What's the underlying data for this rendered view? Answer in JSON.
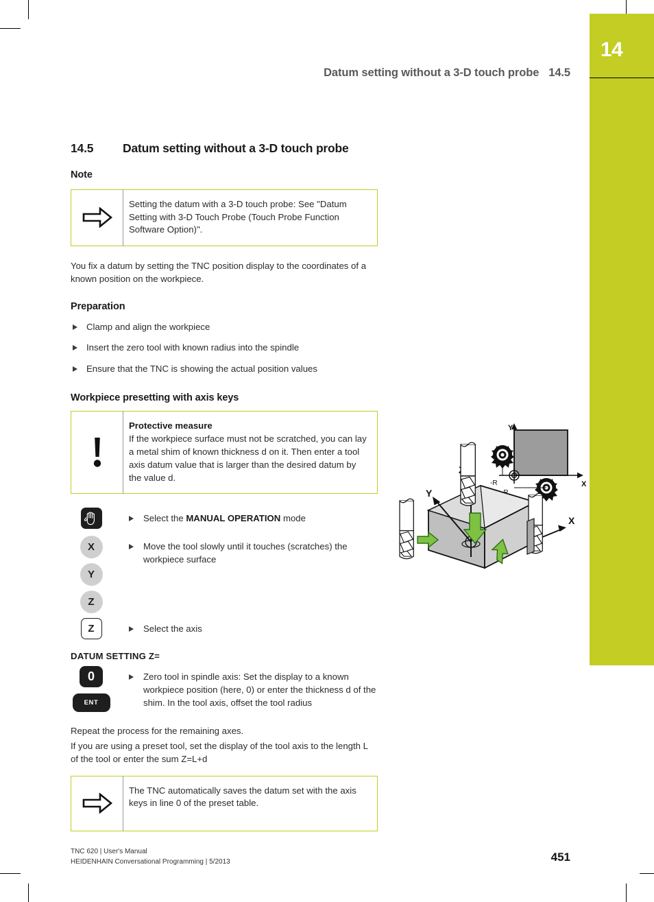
{
  "chapter": {
    "number": "14",
    "accent_color": "#c3cd23"
  },
  "running_header": {
    "title": "Datum setting without a 3-D touch probe",
    "section_number": "14.5"
  },
  "section": {
    "number": "14.5",
    "title": "Datum setting without a 3-D touch probe"
  },
  "note_heading": "Note",
  "note_box": {
    "icon": "arrow-right-outline-icon",
    "text": "Setting the datum with a 3-D touch probe: See \"Datum Setting with 3-D Touch Probe (Touch Probe Function Software Option)\"."
  },
  "intro_paragraph": "You fix a datum by setting the TNC position display to the coordinates of a known position on the workpiece.",
  "preparation": {
    "heading": "Preparation",
    "items": [
      "Clamp and align the workpiece",
      "Insert the zero tool with known radius into the spindle",
      "Ensure that the TNC is showing the actual position values"
    ]
  },
  "presetting": {
    "heading": "Workpiece presetting with axis keys"
  },
  "warning_box": {
    "icon": "exclamation-mark-icon",
    "title": "Protective measure",
    "text": "If the workpiece surface must not be scratched, you can lay a metal shim of known thickness d on it. Then enter a tool axis datum value that is larger than the desired datum by the value d."
  },
  "key_steps": [
    {
      "key_type": "dark-square-hand",
      "key_label": "",
      "icon": "hand-icon",
      "text_before": "Select the ",
      "text_bold": "MANUAL OPERATION",
      "text_after": " mode"
    },
    {
      "key_type": "circle",
      "key_label": "X",
      "icon": "axis-key-x-icon",
      "text_before": "Move the tool slowly until it touches (scratches) the workpiece surface",
      "text_bold": "",
      "text_after": ""
    },
    {
      "key_type": "circle",
      "key_label": "Y",
      "icon": "axis-key-y-icon",
      "text_before": "",
      "text_bold": "",
      "text_after": ""
    },
    {
      "key_type": "circle",
      "key_label": "Z",
      "icon": "axis-key-z-icon",
      "text_before": "",
      "text_bold": "",
      "text_after": ""
    },
    {
      "key_type": "outline-square",
      "key_label": "Z",
      "icon": "soft-key-z-icon",
      "text_before": "Select the axis",
      "text_bold": "",
      "text_after": ""
    }
  ],
  "datum_setting": {
    "label": "DATUM SETTING Z=",
    "key_zero": "0",
    "key_ent": "ENT",
    "text": "Zero tool in spindle axis: Set the display to a known workpiece position (here, 0) or enter the thickness d of the shim. In the tool axis, offset the tool radius"
  },
  "closing": {
    "line1": "Repeat the process for the remaining axes.",
    "line2": "If you are using a preset tool, set the display of the tool axis to the length L of the tool or enter the sum Z=L+d"
  },
  "final_note_box": {
    "icon": "arrow-right-outline-icon",
    "text": "The TNC automatically saves the datum set with the axis keys in line 0 of the preset table."
  },
  "figure": {
    "name": "datum-setting-workpiece-illustration",
    "axis_labels": {
      "x": "X",
      "y": "Y",
      "z": "Z"
    },
    "inset": {
      "axis_x": "X",
      "axis_y": "Y",
      "radius_label_left": "-R",
      "radius_label_bottom": "-R"
    }
  },
  "footer": {
    "line1": "TNC 620 | User's Manual",
    "line2": "HEIDENHAIN Conversational Programming | 5/2013",
    "page": "451"
  }
}
